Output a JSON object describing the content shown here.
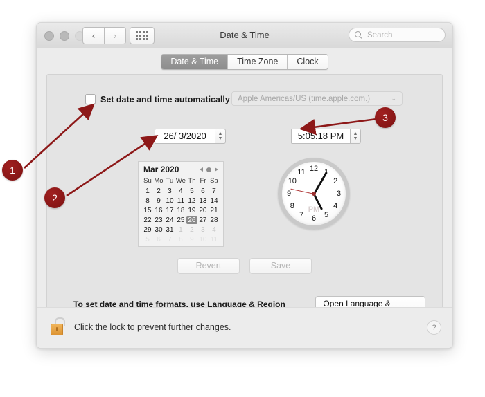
{
  "window": {
    "title": "Date & Time",
    "traffic_lights": [
      "close",
      "minimize",
      "zoom"
    ],
    "nav": {
      "back": "‹",
      "forward": "›",
      "grid": "grid-icon"
    },
    "search": {
      "placeholder": "Search",
      "value": ""
    }
  },
  "tabs": [
    {
      "label": "Date & Time",
      "active": true
    },
    {
      "label": "Time Zone",
      "active": false
    },
    {
      "label": "Clock",
      "active": false
    }
  ],
  "auto": {
    "checkbox_label": "Set date and time automatically:",
    "checked": false,
    "server_value": "Apple Americas/US (time.apple.com.)",
    "server_disabled": true,
    "chevron": "⌄"
  },
  "date_field": {
    "value": "26/  3/2020",
    "stepper_up": "▲",
    "stepper_down": "▼"
  },
  "time_field": {
    "value": "5:05:18 PM",
    "stepper_up": "▲",
    "stepper_down": "▼"
  },
  "calendar": {
    "month_label": "Mar 2020",
    "weekdays": [
      "Su",
      "Mo",
      "Tu",
      "We",
      "Th",
      "Fr",
      "Sa"
    ],
    "selected_day": 26,
    "weeks": [
      [
        {
          "d": 1,
          "t": "cur"
        },
        {
          "d": 2,
          "t": "cur"
        },
        {
          "d": 3,
          "t": "cur"
        },
        {
          "d": 4,
          "t": "cur"
        },
        {
          "d": 5,
          "t": "cur"
        },
        {
          "d": 6,
          "t": "cur"
        },
        {
          "d": 7,
          "t": "cur"
        }
      ],
      [
        {
          "d": 8,
          "t": "cur"
        },
        {
          "d": 9,
          "t": "cur"
        },
        {
          "d": 10,
          "t": "cur"
        },
        {
          "d": 11,
          "t": "cur"
        },
        {
          "d": 12,
          "t": "cur"
        },
        {
          "d": 13,
          "t": "cur"
        },
        {
          "d": 14,
          "t": "cur"
        }
      ],
      [
        {
          "d": 15,
          "t": "cur"
        },
        {
          "d": 16,
          "t": "cur"
        },
        {
          "d": 17,
          "t": "cur"
        },
        {
          "d": 18,
          "t": "cur"
        },
        {
          "d": 19,
          "t": "cur"
        },
        {
          "d": 20,
          "t": "cur"
        },
        {
          "d": 21,
          "t": "cur"
        }
      ],
      [
        {
          "d": 22,
          "t": "cur"
        },
        {
          "d": 23,
          "t": "cur"
        },
        {
          "d": 24,
          "t": "cur"
        },
        {
          "d": 25,
          "t": "cur"
        },
        {
          "d": 26,
          "t": "sel"
        },
        {
          "d": 27,
          "t": "cur"
        },
        {
          "d": 28,
          "t": "cur"
        }
      ],
      [
        {
          "d": 29,
          "t": "cur"
        },
        {
          "d": 30,
          "t": "cur"
        },
        {
          "d": 31,
          "t": "cur"
        },
        {
          "d": 1,
          "t": "out"
        },
        {
          "d": 2,
          "t": "out"
        },
        {
          "d": 3,
          "t": "out"
        },
        {
          "d": 4,
          "t": "out"
        }
      ],
      [
        {
          "d": 5,
          "t": "out2"
        },
        {
          "d": 6,
          "t": "out2"
        },
        {
          "d": 7,
          "t": "out2"
        },
        {
          "d": 8,
          "t": "out2"
        },
        {
          "d": 9,
          "t": "out2"
        },
        {
          "d": 10,
          "t": "out2"
        },
        {
          "d": 11,
          "t": "out2"
        }
      ]
    ]
  },
  "clock": {
    "numbers": [
      "12",
      "1",
      "2",
      "3",
      "4",
      "5",
      "6",
      "7",
      "8",
      "9",
      "10",
      "11"
    ],
    "ampm": "PM",
    "hour": 5,
    "minute": 5,
    "second": 47,
    "hour_angle": 152.5,
    "minute_angle": 30,
    "second_angle": 282,
    "second_hand_color": "#b03838"
  },
  "buttons": {
    "revert": "Revert",
    "save": "Save",
    "revert_disabled": true,
    "save_disabled": true
  },
  "format_row": {
    "text": "To set date and time formats, use Language & Region preferences.",
    "button": "Open Language & Region..."
  },
  "lock_bar": {
    "text": "Click the lock to prevent further changes.",
    "lock_state": "unlocked",
    "help": "?"
  },
  "annotations": [
    {
      "number": "1",
      "target": "set-date-time-automatically-checkbox"
    },
    {
      "number": "2",
      "target": "date-stepper-field"
    },
    {
      "number": "3",
      "target": "time-stepper-field"
    }
  ],
  "colors": {
    "annotation_red": "#7d1212",
    "tab_active_bg": "#8d8d8d",
    "lock_gold": "#dd9433"
  }
}
